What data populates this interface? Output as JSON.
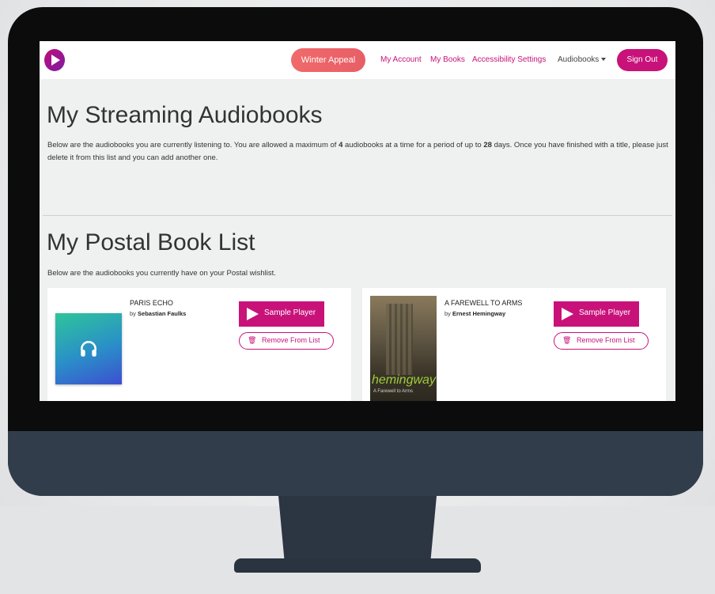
{
  "nav": {
    "appeal": "Winter Appeal",
    "my_account": "My Account",
    "my_books": "My Books",
    "accessibility": "Accessibility Settings",
    "audiobooks": "Audiobooks",
    "sign_out": "Sign Out"
  },
  "streaming": {
    "title": "My Streaming Audiobooks",
    "text_a": "Below are the audiobooks you are currently listening to. You are allowed a maximum of ",
    "max_books": "4",
    "text_b": " audiobooks at a time for a period of up to ",
    "max_days": "28",
    "text_c": " days. Once you have finished with a title, please just delete it from this list and you can add another one."
  },
  "postal": {
    "title": "My Postal Book List",
    "text": "Below are the audiobooks you currently have on your Postal wishlist.",
    "books": [
      {
        "title": "PARIS ECHO",
        "by": "by ",
        "author": "Sebastian Faulks",
        "sample": "Sample Player",
        "remove": "Remove From List"
      },
      {
        "title": "A FAREWELL TO ARMS",
        "by": "by ",
        "author": "Ernest Hemingway",
        "sample": "Sample Player",
        "remove": "Remove From List",
        "cover_text": "hemingway",
        "cover_subtext": "A Farewell to Arms"
      }
    ]
  },
  "icons": {
    "logo": "play-logo-icon",
    "headphones": "headphones-icon",
    "trash": "trash-icon",
    "play": "play-icon",
    "caret": "caret-down-icon"
  },
  "colors": {
    "accent": "#c8127a",
    "appeal": "#ea6268",
    "monitor_bezel": "#0c0c0d",
    "monitor_chin": "#323d4c"
  }
}
